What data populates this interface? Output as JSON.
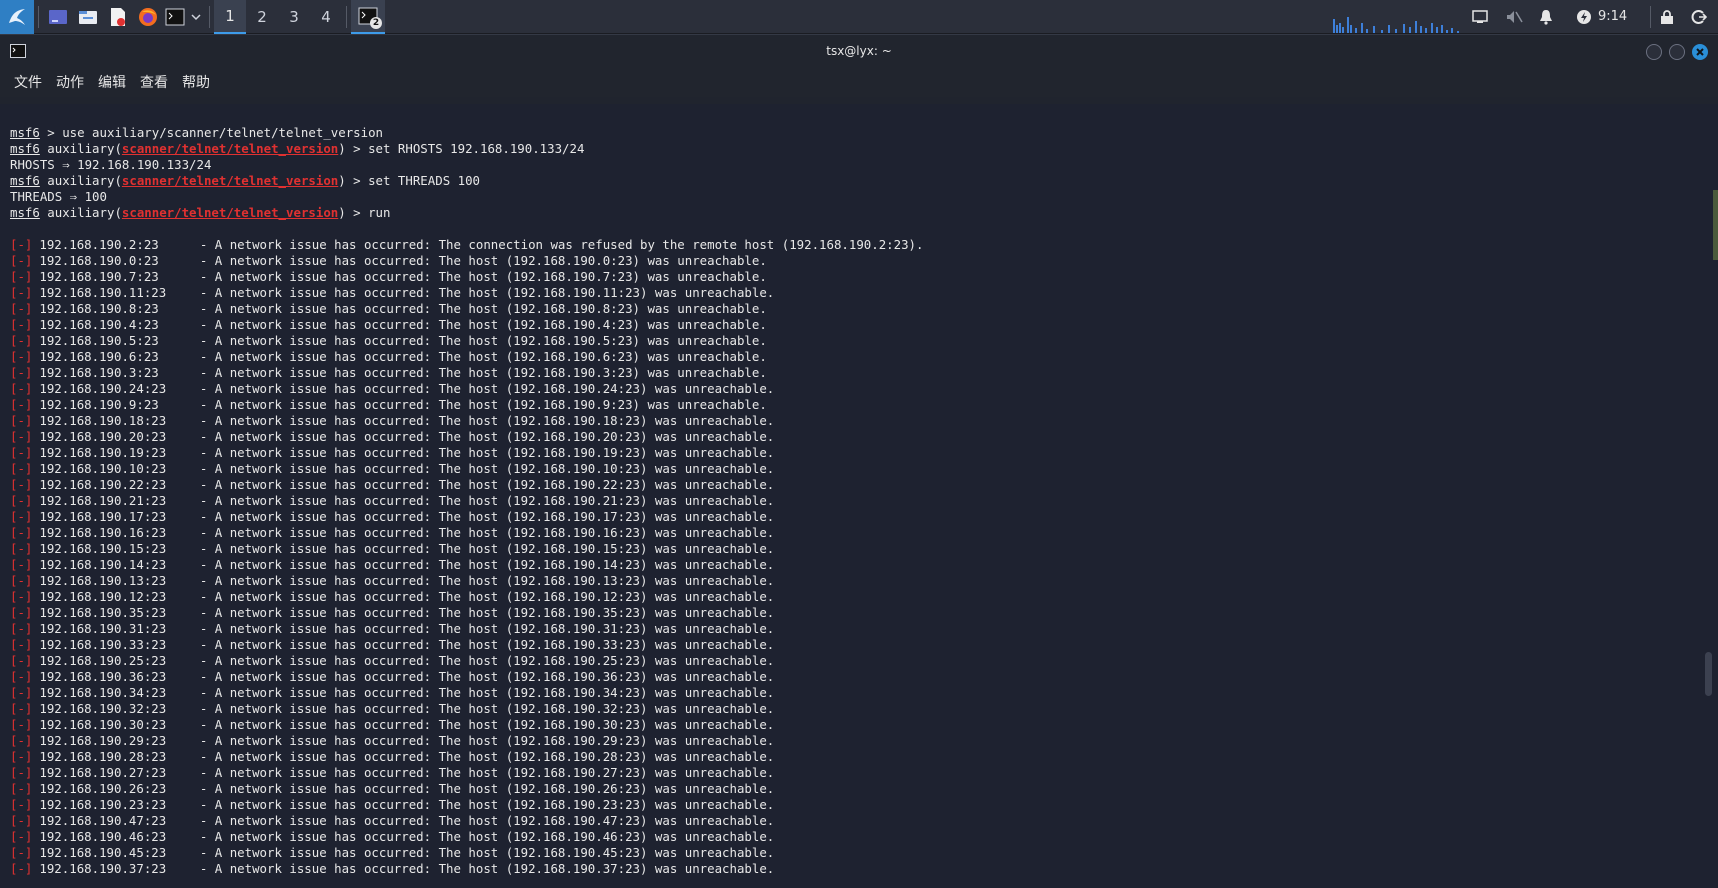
{
  "panel": {
    "workspaces": [
      "1",
      "2",
      "3",
      "4"
    ],
    "active_workspace": "1",
    "terminal_badge": "2",
    "clock": "9:14",
    "icons": [
      "kali-menu-icon",
      "show-desktop-icon",
      "file-manager-icon",
      "text-editor-icon",
      "firefox-icon",
      "terminal-icon",
      "chevron-down-icon",
      "network-icon",
      "volume-muted-icon",
      "notifications-icon",
      "power-icon",
      "lock-icon",
      "logout-icon"
    ]
  },
  "window": {
    "title": "tsx@lyx: ~",
    "menu": [
      "文件",
      "动作",
      "编辑",
      "查看",
      "帮助"
    ]
  },
  "terminal": {
    "prompt": "msf6",
    "module": "scanner/telnet/telnet_version",
    "cmd_use": " > use auxiliary/scanner/telnet/telnet_version",
    "cmd_set_rhosts": "set RHOSTS 192.168.190.133/24",
    "rhosts_echo": "RHOSTS ⇒ 192.168.190.133/24",
    "cmd_set_threads": "set THREADS 100",
    "threads_echo": "THREADS ⇒ 100",
    "cmd_run": "run",
    "aux_prefix": " auxiliary(",
    "aux_suffix": ") > ",
    "error_tag": "[-]",
    "results": [
      {
        "host": "192.168.190.2:23",
        "msg": "The connection was refused by the remote host (192.168.190.2:23)."
      },
      {
        "host": "192.168.190.0:23",
        "msg": "The host (192.168.190.0:23) was unreachable."
      },
      {
        "host": "192.168.190.7:23",
        "msg": "The host (192.168.190.7:23) was unreachable."
      },
      {
        "host": "192.168.190.11:23",
        "msg": "The host (192.168.190.11:23) was unreachable."
      },
      {
        "host": "192.168.190.8:23",
        "msg": "The host (192.168.190.8:23) was unreachable."
      },
      {
        "host": "192.168.190.4:23",
        "msg": "The host (192.168.190.4:23) was unreachable."
      },
      {
        "host": "192.168.190.5:23",
        "msg": "The host (192.168.190.5:23) was unreachable."
      },
      {
        "host": "192.168.190.6:23",
        "msg": "The host (192.168.190.6:23) was unreachable."
      },
      {
        "host": "192.168.190.3:23",
        "msg": "The host (192.168.190.3:23) was unreachable."
      },
      {
        "host": "192.168.190.24:23",
        "msg": "The host (192.168.190.24:23) was unreachable."
      },
      {
        "host": "192.168.190.9:23",
        "msg": "The host (192.168.190.9:23) was unreachable."
      },
      {
        "host": "192.168.190.18:23",
        "msg": "The host (192.168.190.18:23) was unreachable."
      },
      {
        "host": "192.168.190.20:23",
        "msg": "The host (192.168.190.20:23) was unreachable."
      },
      {
        "host": "192.168.190.19:23",
        "msg": "The host (192.168.190.19:23) was unreachable."
      },
      {
        "host": "192.168.190.10:23",
        "msg": "The host (192.168.190.10:23) was unreachable."
      },
      {
        "host": "192.168.190.22:23",
        "msg": "The host (192.168.190.22:23) was unreachable."
      },
      {
        "host": "192.168.190.21:23",
        "msg": "The host (192.168.190.21:23) was unreachable."
      },
      {
        "host": "192.168.190.17:23",
        "msg": "The host (192.168.190.17:23) was unreachable."
      },
      {
        "host": "192.168.190.16:23",
        "msg": "The host (192.168.190.16:23) was unreachable."
      },
      {
        "host": "192.168.190.15:23",
        "msg": "The host (192.168.190.15:23) was unreachable."
      },
      {
        "host": "192.168.190.14:23",
        "msg": "The host (192.168.190.14:23) was unreachable."
      },
      {
        "host": "192.168.190.13:23",
        "msg": "The host (192.168.190.13:23) was unreachable."
      },
      {
        "host": "192.168.190.12:23",
        "msg": "The host (192.168.190.12:23) was unreachable."
      },
      {
        "host": "192.168.190.35:23",
        "msg": "The host (192.168.190.35:23) was unreachable."
      },
      {
        "host": "192.168.190.31:23",
        "msg": "The host (192.168.190.31:23) was unreachable."
      },
      {
        "host": "192.168.190.33:23",
        "msg": "The host (192.168.190.33:23) was unreachable."
      },
      {
        "host": "192.168.190.25:23",
        "msg": "The host (192.168.190.25:23) was unreachable."
      },
      {
        "host": "192.168.190.36:23",
        "msg": "The host (192.168.190.36:23) was unreachable."
      },
      {
        "host": "192.168.190.34:23",
        "msg": "The host (192.168.190.34:23) was unreachable."
      },
      {
        "host": "192.168.190.32:23",
        "msg": "The host (192.168.190.32:23) was unreachable."
      },
      {
        "host": "192.168.190.30:23",
        "msg": "The host (192.168.190.30:23) was unreachable."
      },
      {
        "host": "192.168.190.29:23",
        "msg": "The host (192.168.190.29:23) was unreachable."
      },
      {
        "host": "192.168.190.28:23",
        "msg": "The host (192.168.190.28:23) was unreachable."
      },
      {
        "host": "192.168.190.27:23",
        "msg": "The host (192.168.190.27:23) was unreachable."
      },
      {
        "host": "192.168.190.26:23",
        "msg": "The host (192.168.190.26:23) was unreachable."
      },
      {
        "host": "192.168.190.23:23",
        "msg": "The host (192.168.190.23:23) was unreachable."
      },
      {
        "host": "192.168.190.47:23",
        "msg": "The host (192.168.190.47:23) was unreachable."
      },
      {
        "host": "192.168.190.46:23",
        "msg": "The host (192.168.190.46:23) was unreachable."
      },
      {
        "host": "192.168.190.45:23",
        "msg": "The host (192.168.190.45:23) was unreachable."
      },
      {
        "host": "192.168.190.37:23",
        "msg": "The host (192.168.190.37:23) was unreachable."
      }
    ],
    "error_prefix": " - A network issue has occurred: "
  },
  "colors": {
    "accent": "#3d9be9",
    "error": "#e03131",
    "background": "#1e2230",
    "close_button": "#2a8fd8"
  }
}
